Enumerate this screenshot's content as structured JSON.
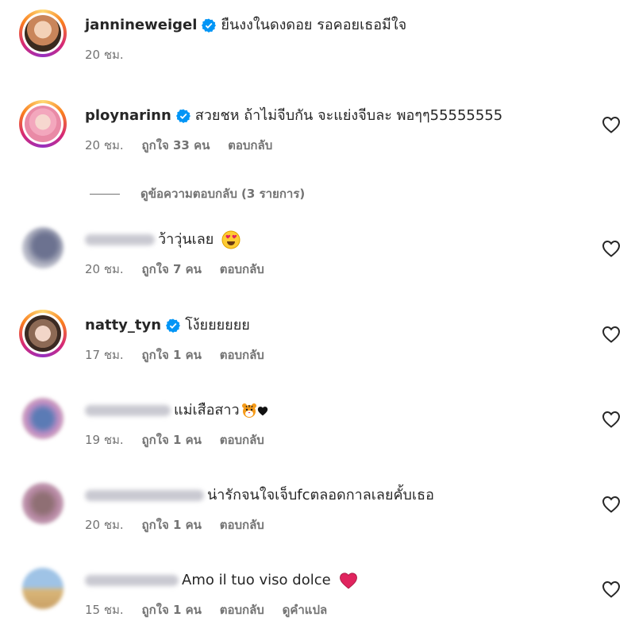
{
  "comments": [
    {
      "username": "jannineweigel",
      "verified": true,
      "text": "ยืนงงในดงดอย รอคอยเธอมีใจ",
      "time": "20 ชม.",
      "likes": "",
      "reply": "",
      "translate": ""
    },
    {
      "username": "ploynarinn",
      "verified": true,
      "text": "สวยชห ถ้าไม่จีบกัน จะแย่งจีบละ พอๆๆ55555555",
      "time": "20 ชม.",
      "likes": "ถูกใจ 33 คน",
      "reply": "ตอบกลับ",
      "translate": ""
    },
    {
      "username": "",
      "verified": false,
      "text": "ว้าวุ่นเลย",
      "time": "20 ชม.",
      "likes": "ถูกใจ 7 คน",
      "reply": "ตอบกลับ",
      "translate": ""
    },
    {
      "username": "natty_tyn",
      "verified": true,
      "text": "โง้ยยยยยย",
      "time": "17 ชม.",
      "likes": "ถูกใจ 1 คน",
      "reply": "ตอบกลับ",
      "translate": ""
    },
    {
      "username": "",
      "verified": false,
      "text": "แม่เสือสาว",
      "time": "19 ชม.",
      "likes": "ถูกใจ 1 คน",
      "reply": "ตอบกลับ",
      "translate": ""
    },
    {
      "username": "",
      "verified": false,
      "text": "น่ารักจนใจเจ็บfcตลอดกาลเลยคั้บเธอ",
      "time": "20 ชม.",
      "likes": "ถูกใจ 1 คน",
      "reply": "ตอบกลับ",
      "translate": ""
    },
    {
      "username": "",
      "verified": false,
      "text": "Amo il tuo viso dolce",
      "time": "15 ชม.",
      "likes": "ถูกใจ 1 คน",
      "reply": "ตอบกลับ",
      "translate": "ดูคำแปล"
    }
  ],
  "view_replies": "ดูข้อความตอบกลับ (3 รายการ)",
  "colors": {
    "text": "#262626",
    "secondary": "#737373",
    "verified": "#0095f6",
    "heart_emoji": "#e0245e"
  },
  "icons": [
    "verified-badge-icon",
    "heart-outline-icon",
    "heart-eyes-emoji",
    "tiger-emoji",
    "black-heart-emoji",
    "red-heart-emoji"
  ]
}
